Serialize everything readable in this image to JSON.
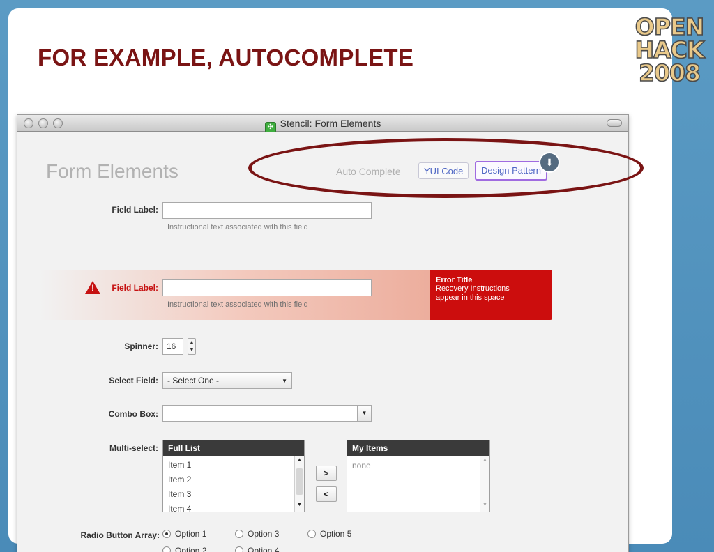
{
  "slide": {
    "title": "FOR EXAMPLE, AUTOCOMPLETE",
    "logo": [
      "OPEN",
      "HACK",
      "2008"
    ]
  },
  "window": {
    "title": "Stencil: Form Elements"
  },
  "form": {
    "heading": "Form Elements",
    "nav": {
      "label": "Auto Complete",
      "yui": "YUI Code",
      "pattern": "Design Pattern"
    },
    "field1": {
      "label": "Field Label:",
      "hint": "Instructional text associated with this field"
    },
    "field2": {
      "label": "Field Label:",
      "hint": "Instructional text associated with this field"
    },
    "error": {
      "title": "Error Title",
      "line1": "Recovery Instructions",
      "line2": "appear in this space"
    },
    "spinner": {
      "label": "Spinner:",
      "value": "16"
    },
    "select": {
      "label": "Select Field:",
      "value": "- Select One -"
    },
    "combo": {
      "label": "Combo Box:"
    },
    "multi": {
      "label": "Multi-select:",
      "full_title": "Full List",
      "items": [
        "Item 1",
        "Item 2",
        "Item 3",
        "Item 4"
      ],
      "add": ">",
      "remove": "<",
      "my_title": "My Items",
      "my_empty": "none"
    },
    "radio": {
      "label": "Radio Button Array:",
      "options": [
        "Option 1",
        "Option 2",
        "Option 3",
        "Option 4",
        "Option 5"
      ]
    }
  }
}
